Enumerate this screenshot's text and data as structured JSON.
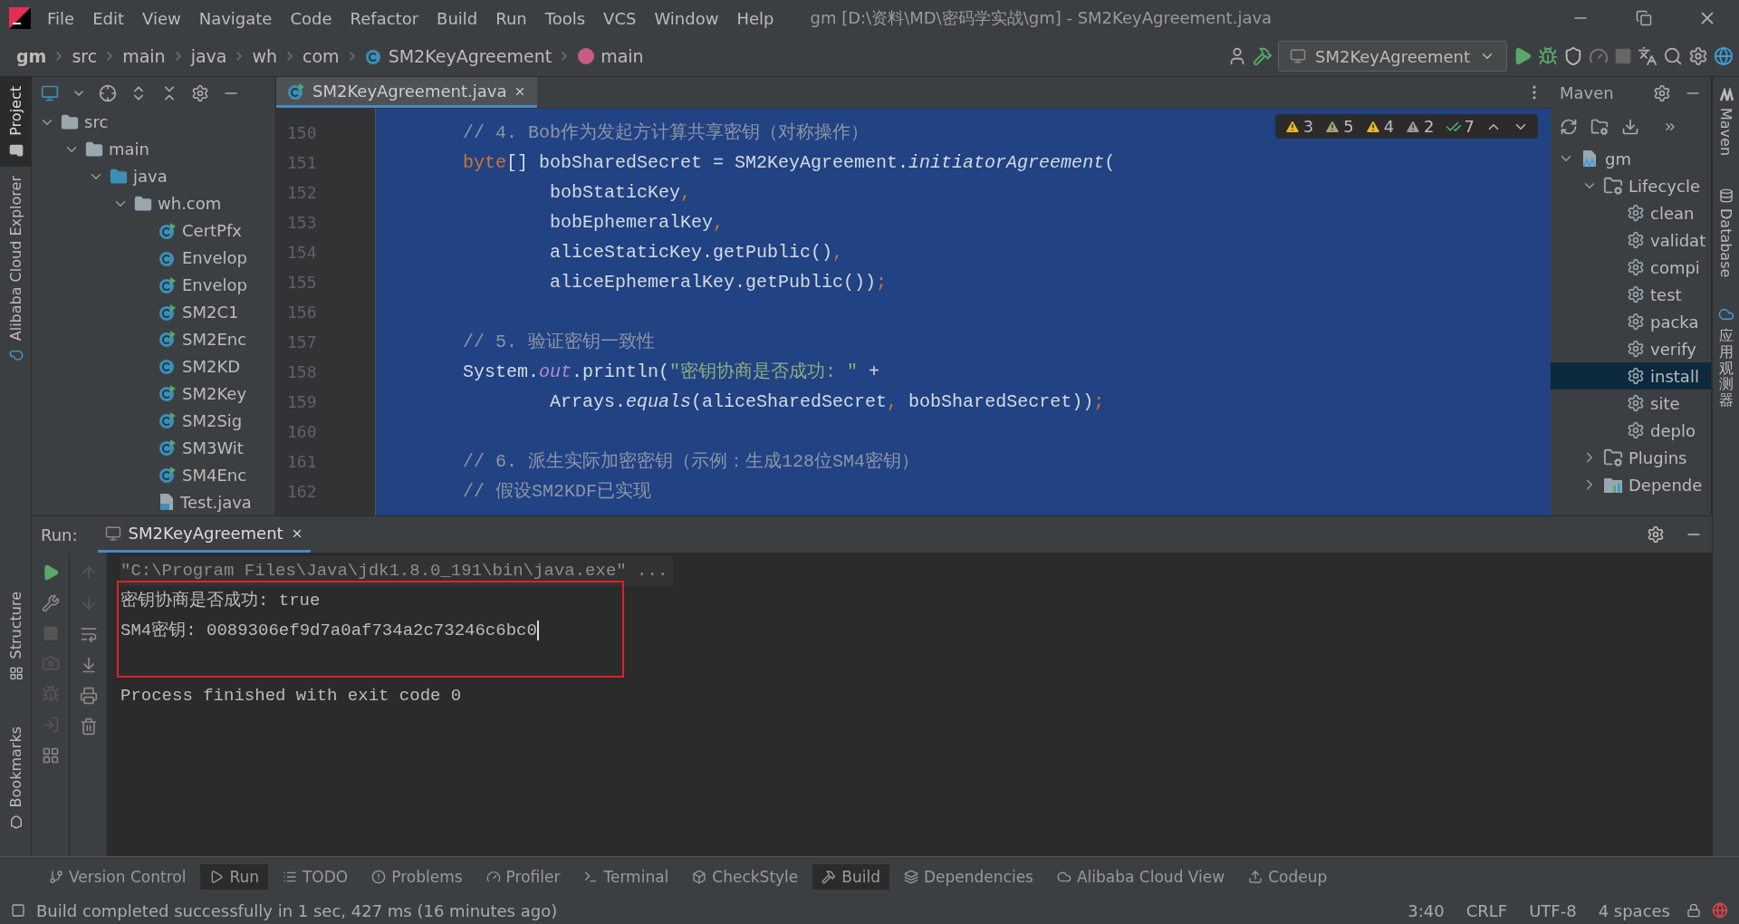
{
  "menu_bar": {
    "items": [
      "File",
      "Edit",
      "View",
      "Navigate",
      "Code",
      "Refactor",
      "Build",
      "Run",
      "Tools",
      "VCS",
      "Window",
      "Help"
    ],
    "title": "gm [D:\\资料\\MD\\密码学实战\\gm] - SM2KeyAgreement.java"
  },
  "breadcrumbs": [
    {
      "label": "gm",
      "kind": "project"
    },
    {
      "label": "src",
      "kind": "dir"
    },
    {
      "label": "main",
      "kind": "dir"
    },
    {
      "label": "java",
      "kind": "dir"
    },
    {
      "label": "wh",
      "kind": "dir"
    },
    {
      "label": "com",
      "kind": "dir"
    },
    {
      "label": "SM2KeyAgreement",
      "kind": "class"
    },
    {
      "label": "main",
      "kind": "method"
    }
  ],
  "run_config": {
    "label": "SM2KeyAgreement"
  },
  "left_stripe_top": [
    {
      "label": "Project",
      "selected": true
    },
    {
      "label": "Alibaba Cloud Explorer",
      "selected": false
    }
  ],
  "left_stripe_bottom": [
    {
      "label": "Structure",
      "selected": false
    },
    {
      "label": "Bookmarks",
      "selected": false
    }
  ],
  "right_stripe": [
    {
      "label": "Maven",
      "kind": "latin"
    },
    {
      "label": "Database",
      "kind": "latin"
    },
    {
      "label": "应用观测器",
      "kind": "cjk"
    }
  ],
  "project_tree": [
    {
      "label": "src",
      "kind": "folder",
      "expanded": true,
      "children": [
        {
          "label": "main",
          "kind": "folder",
          "expanded": true,
          "children": [
            {
              "label": "java",
              "kind": "source-folder",
              "expanded": true,
              "children": [
                {
                  "label": "wh.com",
                  "kind": "package",
                  "expanded": true,
                  "children": [
                    {
                      "label": "CertPfx",
                      "kind": "runnable-class"
                    },
                    {
                      "label": "Envelop",
                      "kind": "class"
                    },
                    {
                      "label": "Envelop",
                      "kind": "runnable-class"
                    },
                    {
                      "label": "SM2C1",
                      "kind": "runnable-class"
                    },
                    {
                      "label": "SM2Enc",
                      "kind": "runnable-class"
                    },
                    {
                      "label": "SM2KD",
                      "kind": "class"
                    },
                    {
                      "label": "SM2Key",
                      "kind": "runnable-class"
                    },
                    {
                      "label": "SM2Sig",
                      "kind": "runnable-class"
                    },
                    {
                      "label": "SM3Wit",
                      "kind": "runnable-class"
                    },
                    {
                      "label": "SM4Enc",
                      "kind": "runnable-class"
                    },
                    {
                      "label": "Test.java",
                      "kind": "java-file"
                    }
                  ]
                }
              ]
            }
          ]
        }
      ]
    }
  ],
  "editor": {
    "tab": {
      "label": "SM2KeyAgreement.java"
    },
    "inspections": [
      {
        "kind": "warning",
        "count": "3",
        "color": "#e8b530"
      },
      {
        "kind": "warning",
        "count": "5",
        "color": "#a7a07a"
      },
      {
        "kind": "warning",
        "count": "4",
        "color": "#e8b530"
      },
      {
        "kind": "warning",
        "count": "2",
        "color": "#9a9a9a"
      },
      {
        "kind": "check",
        "count": "7",
        "color": "#4fb56b"
      }
    ],
    "lines": [
      {
        "number": "150",
        "tokens": [
          {
            "kind": "comment",
            "text": "// 4. Bob作为发起方计算共享密钥（对称操作）"
          }
        ]
      },
      {
        "number": "151",
        "tokens": [
          {
            "kind": "keyword",
            "text": "byte"
          },
          {
            "kind": "plain",
            "text": "[] bobSharedSecret = SM2KeyAgreement."
          },
          {
            "kind": "static",
            "text": "initiatorAgreement"
          },
          {
            "kind": "plain",
            "text": "("
          }
        ]
      },
      {
        "number": "152",
        "tokens": [
          {
            "kind": "plain",
            "text": "        bobStaticKey"
          },
          {
            "kind": "keyword",
            "text": ","
          }
        ]
      },
      {
        "number": "153",
        "tokens": [
          {
            "kind": "plain",
            "text": "        bobEphemeralKey"
          },
          {
            "kind": "keyword",
            "text": ","
          }
        ]
      },
      {
        "number": "154",
        "tokens": [
          {
            "kind": "plain",
            "text": "        aliceStaticKey.getPublic()"
          },
          {
            "kind": "keyword",
            "text": ","
          }
        ]
      },
      {
        "number": "155",
        "tokens": [
          {
            "kind": "plain",
            "text": "        aliceEphemeralKey.getPublic())"
          },
          {
            "kind": "keyword",
            "text": ";"
          }
        ]
      },
      {
        "number": "156"
      },
      {
        "number": "157",
        "tokens": [
          {
            "kind": "comment",
            "text": "// 5. 验证密钥一致性"
          }
        ]
      },
      {
        "number": "158",
        "tokens": [
          {
            "kind": "plain",
            "text": "System."
          },
          {
            "kind": "field",
            "text": "out"
          },
          {
            "kind": "plain",
            "text": ".println("
          },
          {
            "kind": "string",
            "text": "\"密钥协商是否成功: \""
          },
          {
            "kind": "plain",
            "text": " +"
          }
        ]
      },
      {
        "number": "159",
        "tokens": [
          {
            "kind": "plain",
            "text": "        Arrays."
          },
          {
            "kind": "static",
            "text": "equals"
          },
          {
            "kind": "plain",
            "text": "(aliceSharedSecret"
          },
          {
            "kind": "keyword",
            "text": ","
          },
          {
            "kind": "plain",
            "text": " bobSharedSecret))"
          },
          {
            "kind": "keyword",
            "text": ";"
          }
        ]
      },
      {
        "number": "160"
      },
      {
        "number": "161",
        "tokens": [
          {
            "kind": "comment",
            "text": "// 6. 派生实际加密密钥（示例：生成128位SM4密钥）"
          }
        ]
      },
      {
        "number": "162",
        "tokens": [
          {
            "kind": "comment",
            "text": "// 假设SM2KDF已实现"
          }
        ]
      }
    ]
  },
  "maven": {
    "title": "Maven",
    "tree": [
      {
        "label": "gm",
        "kind": "project",
        "expanded": true,
        "selected": false,
        "children": [
          {
            "label": "Lifecycle",
            "kind": "group",
            "expanded": true,
            "selected": false,
            "children": [
              {
                "label": "clean",
                "kind": "goal",
                "selected": false
              },
              {
                "label": "validat",
                "kind": "goal",
                "selected": false
              },
              {
                "label": "compi",
                "kind": "goal",
                "selected": false
              },
              {
                "label": "test",
                "kind": "goal",
                "selected": false
              },
              {
                "label": "packa",
                "kind": "goal",
                "selected": false
              },
              {
                "label": "verify",
                "kind": "goal",
                "selected": false
              },
              {
                "label": "install",
                "kind": "goal",
                "selected": true
              },
              {
                "label": "site",
                "kind": "goal",
                "selected": false
              },
              {
                "label": "deplo",
                "kind": "goal",
                "selected": false
              }
            ]
          },
          {
            "label": "Plugins",
            "kind": "group",
            "expanded": false,
            "selected": false
          },
          {
            "label": "Depende",
            "kind": "deps",
            "expanded": false,
            "selected": false
          }
        ]
      }
    ]
  },
  "run_panel": {
    "label": "Run:",
    "tab": {
      "label": "SM2KeyAgreement"
    },
    "console": [
      {
        "kind": "command",
        "text": "\"C:\\Program Files\\Java\\jdk1.8.0_191\\bin\\java.exe\" ..."
      },
      {
        "kind": "output",
        "text": "密钥协商是否成功: true",
        "highlighted": true
      },
      {
        "kind": "output",
        "text": "SM4密钥: 0089306ef9d7a0af734a2c73246c6bc0",
        "highlighted": true,
        "caret": true
      },
      {
        "kind": "blank",
        "highlighted": true
      },
      {
        "kind": "output",
        "text": "Process finished with exit code 0",
        "highlighted": false
      }
    ]
  },
  "tool_windows": [
    {
      "label": "Version Control",
      "selected": false
    },
    {
      "label": "Run",
      "selected": true
    },
    {
      "label": "TODO",
      "selected": false
    },
    {
      "label": "Problems",
      "selected": false
    },
    {
      "label": "Profiler",
      "selected": false
    },
    {
      "label": "Terminal",
      "selected": false
    },
    {
      "label": "CheckStyle",
      "selected": false
    },
    {
      "label": "Build",
      "selected": true
    },
    {
      "label": "Dependencies",
      "selected": false
    },
    {
      "label": "Alibaba Cloud View",
      "selected": false
    },
    {
      "label": "Codeup",
      "selected": false
    }
  ],
  "status_bar": {
    "message": "Build completed successfully in 1 sec, 427 ms (16 minutes ago)",
    "items": [
      "3:40",
      "CRLF",
      "UTF-8",
      "4 spaces"
    ]
  }
}
